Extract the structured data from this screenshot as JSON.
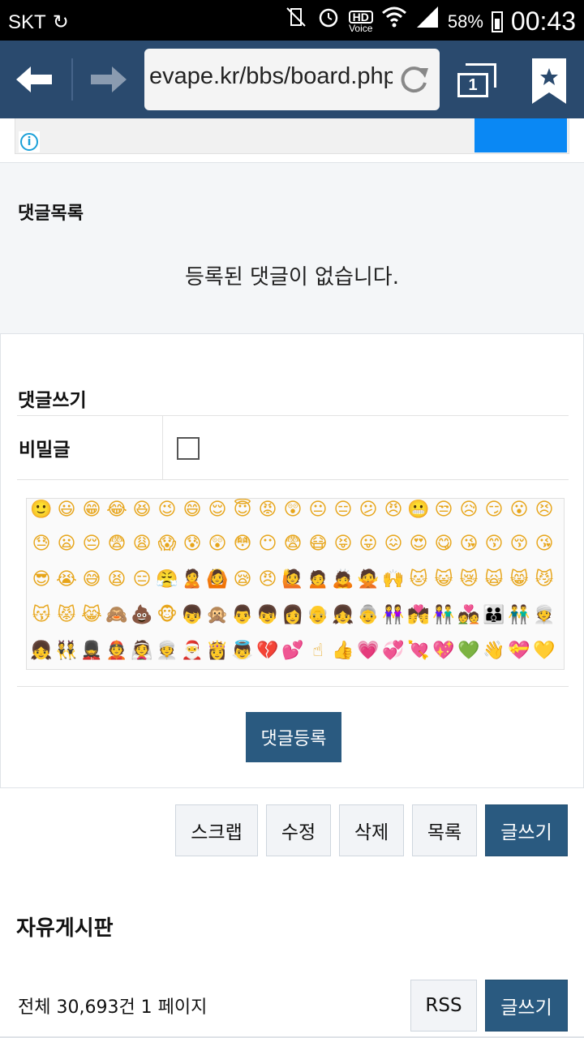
{
  "status_bar": {
    "carrier": "SKT",
    "hd_label": "HD",
    "voice_label": "Voice",
    "battery": "58%",
    "time": "00:43"
  },
  "browser": {
    "url": "evape.kr/bbs/board.php",
    "tab_count": "1"
  },
  "comments": {
    "list_title": "댓글목록",
    "empty_message": "등록된 댓글이 없습니다."
  },
  "comment_form": {
    "title": "댓글쓰기",
    "secret_label": "비밀글",
    "secret_checked": false,
    "submit_label": "댓글등록"
  },
  "emoji_rows": [
    [
      "🙂",
      "😃",
      "😁",
      "😂",
      "😆",
      "😉",
      "😄",
      "😌",
      "😇",
      "😡",
      "😲",
      "😐",
      "😑",
      "😕",
      "😠",
      "😬",
      "😒",
      "😥",
      "😏",
      "😮",
      "😣"
    ],
    [
      "😓",
      "😦",
      "😔",
      "😨",
      "😩",
      "😱",
      "😰",
      "😲",
      "😳",
      "😶",
      "😨",
      "😷",
      "😝",
      "😛",
      "😖",
      "😍",
      "😋",
      "😘",
      "😙",
      "😚",
      "😘"
    ],
    [
      "😎",
      "😭",
      "😅",
      "😫",
      "😑",
      "😤",
      "🙎",
      "🙆",
      "😪",
      "😠",
      "🙋",
      "🙍",
      "🙇",
      "🙅",
      "🙌",
      "🐱",
      "😺",
      "😿",
      "🙀",
      "😸",
      "😼"
    ],
    [
      "😽",
      "😾",
      "😹",
      "🙈",
      "💩",
      "🐵",
      "👦",
      "🙊",
      "👨",
      "👦",
      "👩",
      "👴",
      "👧",
      "👵",
      "👭",
      "💏",
      "👫",
      "💑",
      "👪",
      "👬",
      "👳"
    ],
    [
      "👧",
      "👯",
      "💂",
      "👲",
      "👰",
      "👳",
      "🎅",
      "👸",
      "👼",
      "💔",
      "💕",
      "☝",
      "👍",
      "💗",
      "💞",
      "💘",
      "💖",
      "💚",
      "👋",
      "💝",
      "💛"
    ]
  ],
  "actions": {
    "scrap": "스크랩",
    "edit": "수정",
    "delete": "삭제",
    "list": "목록",
    "write": "글쓰기"
  },
  "board": {
    "title": "자유게시판",
    "count_text": "전체 30,693건 1 페이지",
    "rss": "RSS",
    "write": "글쓰기"
  }
}
